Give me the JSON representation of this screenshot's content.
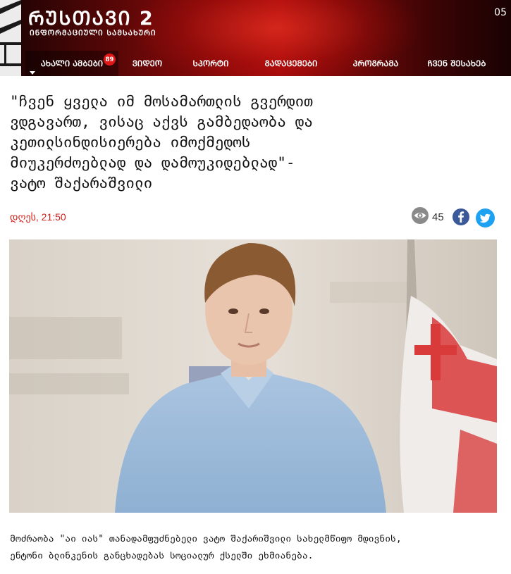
{
  "brand": {
    "title": "ᲠᲣᲡᲗᲐᲕᲘ 2",
    "subtitle": "ᲘᲜᲤᲝᲠᲛᲐᲪᲘᲣᲚᲘ ᲡᲐᲛᲡᲐᲮᲣᲠᲘ",
    "logo_icon": "rustavi2-logo-icon"
  },
  "header": {
    "date": "05"
  },
  "nav": {
    "items": [
      {
        "label": "ᲐᲮᲐᲚᲘ ᲐᲛᲑᲔᲑᲘ",
        "badge": "89",
        "active": true
      },
      {
        "label": "ᲕᲘᲓᲔᲝ"
      },
      {
        "label": "ᲡᲞᲝᲠᲢᲘ"
      },
      {
        "label": "ᲒᲐᲓᲐᲪᲔᲛᲔᲑᲘ"
      },
      {
        "label": "ᲞᲠᲝᲒᲠᲐᲛᲐ"
      },
      {
        "label": "ᲩᲕᲔᲜ ᲨᲔᲡᲐᲮᲔᲑ"
      }
    ]
  },
  "article": {
    "headline_lines": [
      "\"ჩვენ ყველა იმ მოსამართლის გვერდით",
      "ვდგავართ, ვისაც აქვს გამბედაობა და",
      "კეთილსინდისიერება იმოქმედოს",
      "მიუკერძოებლად და დამოუკიდებლად\"-",
      "ვატო შაქარაშვილი"
    ],
    "time": "დღეს, 21:50",
    "views": "45",
    "views_icon": "eye-icon",
    "share_icons": [
      "facebook-icon",
      "twitter-icon"
    ],
    "lead_lines": [
      "მოძრაობა \"აი იას\" თანადამფუძნებელი ვატო შაქარიშვილი სახელმწიფო მდივნის,",
      "ენტონი ბლინკენის განცხადებას სოციალურ ქსელში ეხმიანება."
    ]
  },
  "colors": {
    "accent_red": "#d0201a",
    "header_dark": "#1a0303",
    "header_red": "#a20b0b",
    "facebook_blue": "#3b5998",
    "twitter_blue": "#1da1f2"
  }
}
